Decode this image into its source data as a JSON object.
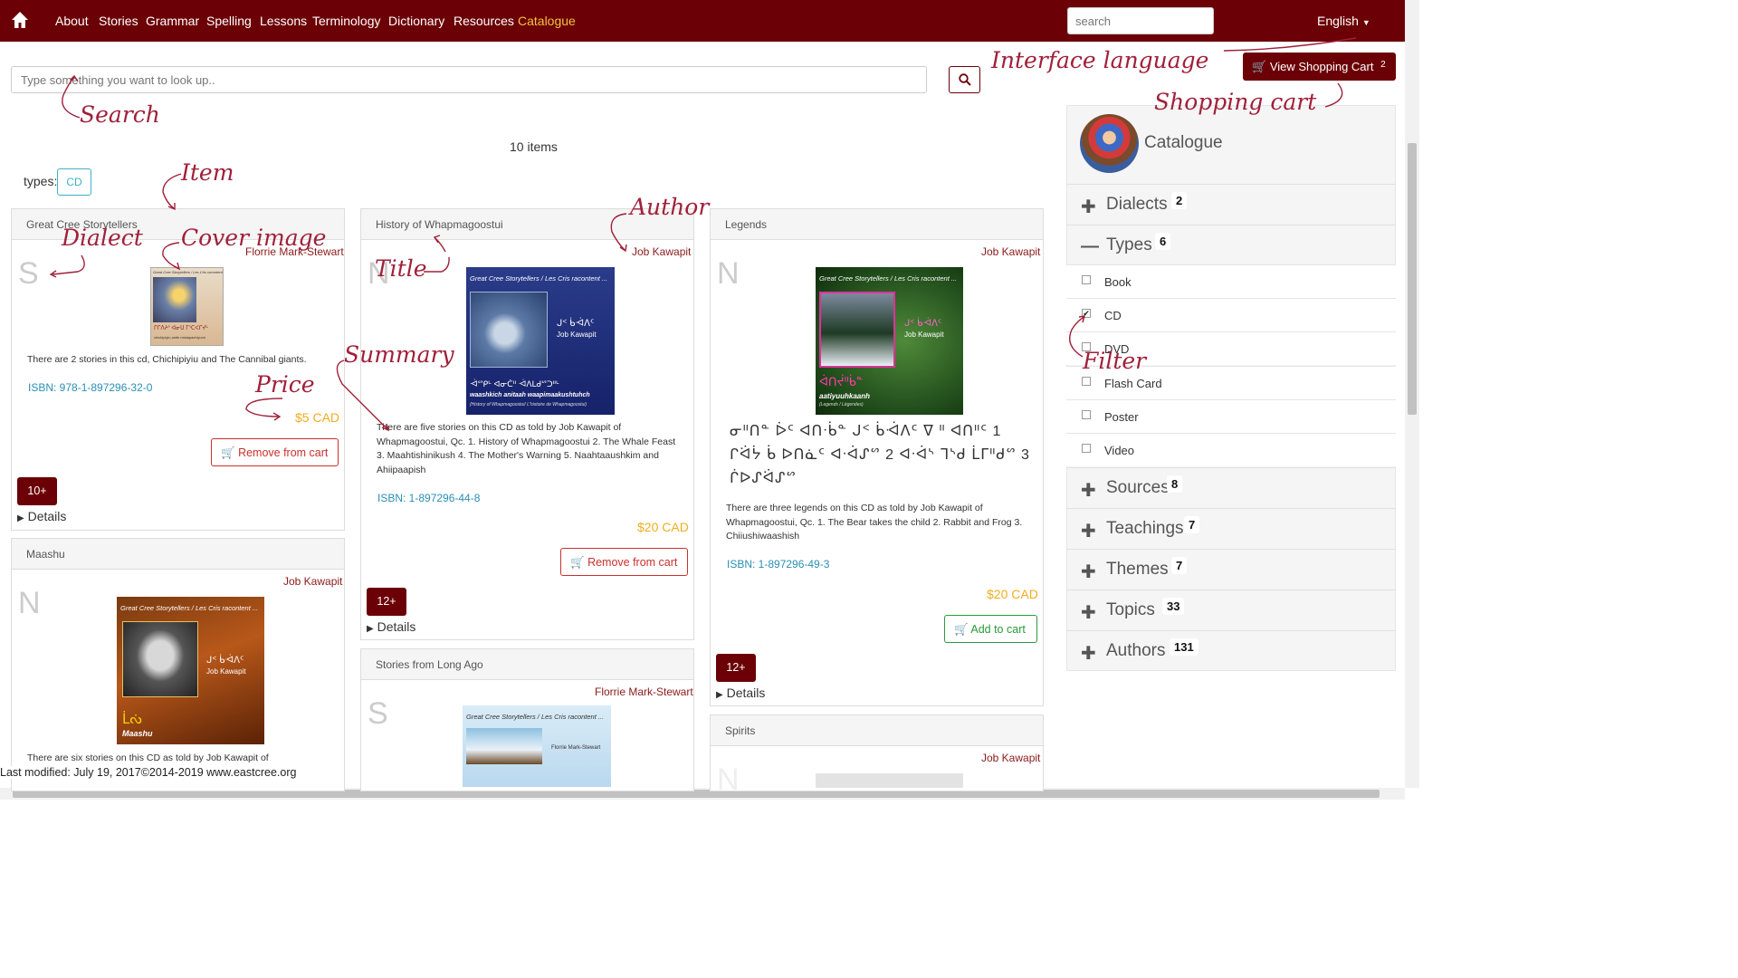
{
  "nav": {
    "links": [
      "About",
      "Stories",
      "Grammar",
      "Spelling",
      "Lessons",
      "Terminology",
      "Dictionary",
      "Resources",
      "Catalogue"
    ],
    "search_placeholder": "search",
    "language": "English"
  },
  "search": {
    "placeholder": "Type something you want to look up.."
  },
  "cart": {
    "label": "View Shopping Cart",
    "count": "2"
  },
  "results": {
    "count_label": "10 items",
    "types_label": "types:",
    "type_chip": "CD"
  },
  "items": [
    {
      "title": "Great Cree Storytellers",
      "author": "Florrie Mark-Stewart",
      "dialect": "S",
      "summary": "There are 2 stories in this cd, Chichipiyiu and The Cannibal giants.",
      "isbn": "ISBN: 978-1-897296-32-0",
      "price": "$5 CAD",
      "action": "Remove from cart",
      "age": "10+",
      "details": "Details",
      "cover_text": "Great Cree Storytellers / Les Cris racontent",
      "cover_syllabics": "ᒋᒋᐱᔨᐤ ᐊᓂᑌ ᒥᔅᑕᐸᒋᔪᒡ",
      "cover_latin": "chichipiyiu anite mistapachiyuch"
    },
    {
      "title": "History of Whapmagoostui",
      "author": "Job Kawapit",
      "dialect": "N",
      "summary": "There are five stories on this CD as told by Job Kawapit of Whapmagoostui, Qc. 1. History of Whapmagoostui 2. The Whale Feast 3. Maahtishinikush 4. The Mother's Warning 5. Naahtaaushkim and Ahiipaapish",
      "isbn": "ISBN: 1-897296-44-8",
      "price": "$20 CAD",
      "action": "Remove from cart",
      "age": "12+",
      "details": "Details",
      "cover_text": "Great Cree Storytellers / Les Cris racontent ...",
      "cover_author": "Job Kawapit",
      "cover_syllabics_top": "ᒍᑉ ᑳᐙᐱᑦ",
      "cover_syllabics": "ᐙᔥᑭᒡ ᐊᓂᑖᐦ ᐙᐱᒪᑯᔥᑐᐦᒡ",
      "cover_latin": "waashkich anitaah waapimaakushtuhch",
      "cover_sub": "(History of Whapmagoostui/ L'histoire de Whapmagoostui)"
    },
    {
      "title": "Legends",
      "author": "Job Kawapit",
      "dialect": "N",
      "syllabics": "ᓂᐦᑎᓐ ᐆᑦ ᐊᑎᐧᑳᓐ ᒍᑉ ᑳᐙᐱᑦ ᐁ ᐦ ᐊᑎᐦᑦ 1 ᒋᐛᔮ ᑳ ᐅᑎᓈᑦ ᐊᐧᐋᔑᔥ 2 ᐊᐧᐋᔅ ᒣᔅᑯ ᒫᒥᐦᑯᔥ 3 ᒌᐅᔑᐛᔑᔥ",
      "summary": "There are three legends on this CD as told by Job Kawapit of Whapmagoostui, Qc. 1. The Bear takes the child 2. Rabbit and Frog 3. Chiiushiwaashish",
      "isbn": "ISBN: 1-897296-49-3",
      "price": "$20 CAD",
      "action": "Add to cart",
      "age": "12+",
      "details": "Details",
      "cover_text": "Great Cree Storytellers / Les Cris racontent ...",
      "cover_author": "Job Kawapit",
      "cover_syllabics_top": "ᒍᑉ ᑳᐙᐱᑦ",
      "cover_syllabics": "ᐋᑎᔫᐦᑳᓐ",
      "cover_latin": "aatiyuuhkaanh",
      "cover_sub": "(Legends / Légendes)"
    },
    {
      "title": "Maashu",
      "author": "Job Kawapit",
      "dialect": "N",
      "summary": "There are six stories on this CD as told by Job Kawapit of",
      "cover_text": "Great Cree Storytellers / Les Cris racontent ...",
      "cover_author": "Job Kawapit",
      "cover_syllabics_top": "ᒍᑉ ᑳᐙᐱᑦ",
      "cover_syllabics": "ᒫᔔ",
      "cover_latin": "Maashu"
    },
    {
      "title": "Stories from Long Ago",
      "author": "Florrie Mark-Stewart",
      "dialect": "S",
      "cover_text": "Great Cree Storytellers / Les Cris racontent ...",
      "cover_author": "Florrie Mark-Stewart"
    },
    {
      "title": "Spirits",
      "author": "Job Kawapit",
      "dialect": "N"
    }
  ],
  "sidebar": {
    "title": "Catalogue",
    "facets": [
      {
        "label": "Dialects",
        "count": "2",
        "icon": "plus-icon"
      },
      {
        "label": "Types",
        "count": "6",
        "icon": "minus-icon"
      },
      {
        "label": "Sources",
        "count": "8",
        "icon": "plus-icon"
      },
      {
        "label": "Teachings",
        "count": "7",
        "icon": "plus-icon"
      },
      {
        "label": "Themes",
        "count": "7",
        "icon": "plus-icon"
      },
      {
        "label": "Topics",
        "count": "33",
        "icon": "plus-icon"
      },
      {
        "label": "Authors",
        "count": "131",
        "icon": "plus-icon"
      }
    ],
    "type_filters": [
      {
        "label": "Book",
        "checked": false
      },
      {
        "label": "CD",
        "checked": true
      },
      {
        "label": "DVD",
        "checked": false
      },
      {
        "label": "Flash Card",
        "checked": false
      },
      {
        "label": "Poster",
        "checked": false
      },
      {
        "label": "Video",
        "checked": false
      }
    ]
  },
  "annotations": {
    "interface_language": "Interface language",
    "search": "Search",
    "shopping_cart": "Shopping cart",
    "item": "Item",
    "dialect": "Dialect",
    "cover_image": "Cover image",
    "title": "Title",
    "author": "Author",
    "summary": "Summary",
    "price": "Price",
    "filter": "Filter"
  },
  "footer": {
    "text": "Last modified: July 19, 2017©2014-2019 www.eastcree.org"
  },
  "colors": {
    "brand": "#6b0006",
    "link": "#2a8fb3",
    "price": "#f0ad1e",
    "annotation": "#a0203a",
    "nav_active": "#f5c242"
  }
}
